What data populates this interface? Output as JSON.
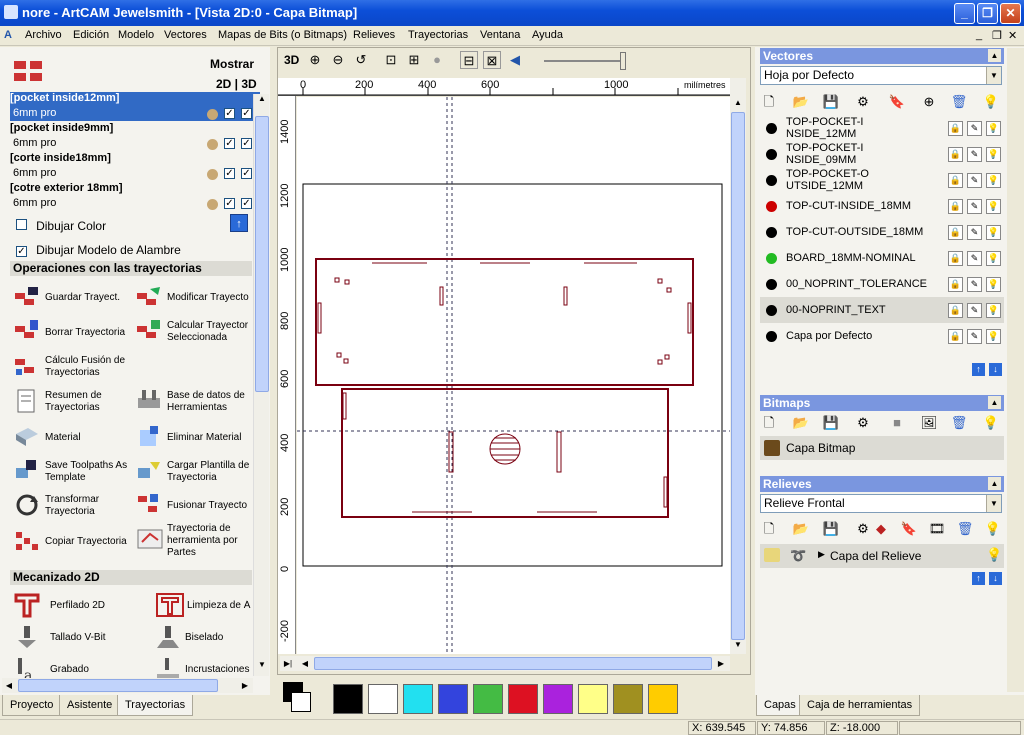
{
  "window": {
    "title": "nore - ArtCAM Jewelsmith - [Vista 2D:0 - Capa Bitmap]"
  },
  "menu": [
    "Archivo",
    "Edición",
    "Modelo",
    "Vectores",
    "Mapas de Bits (o Bitmaps)",
    "Relieves",
    "Trayectorias",
    "Ventana",
    "Ayuda"
  ],
  "left": {
    "mostrar": "Mostrar",
    "view_toggle": "2D | 3D",
    "toolpaths": [
      {
        "name": "[pocket inside12mm]",
        "tool": "6mm pro",
        "selected": true
      },
      {
        "name": "[pocket inside9mm]",
        "tool": "6mm pro",
        "selected": false
      },
      {
        "name": "[corte inside18mm]",
        "tool": "6mm pro",
        "selected": false
      },
      {
        "name": "[cotre exterior 18mm]",
        "tool": "6mm pro",
        "selected": false
      }
    ],
    "dibujar_color": "Dibujar Color",
    "dibujar_modelo": "Dibujar Modelo de Alambre",
    "section_ops": "Operaciones con las trayectorias",
    "ops": [
      {
        "l1": "Guardar Trayect.",
        "l2": ""
      },
      {
        "l1": "Modificar Trayecto",
        "l2": ""
      },
      {
        "l1": "Borrar Trayectoria",
        "l2": ""
      },
      {
        "l1": "Calcular Trayector",
        "l2": "Seleccionada"
      },
      {
        "l1": "Cálculo Fusión de",
        "l2": "Trayectorias"
      },
      {
        "l1": "Base de datos de",
        "l2": "Herramientas"
      },
      {
        "l1": "Resumen de",
        "l2": "Trayectorias"
      },
      {
        "l1": "Material",
        "l2": ""
      },
      {
        "l1": "Eliminar Material",
        "l2": ""
      },
      {
        "l1": "Save Toolpaths As",
        "l2": "Template"
      },
      {
        "l1": "Cargar Plantilla de",
        "l2": "Trayectoria"
      },
      {
        "l1": "Transformar",
        "l2": "Trayectoria"
      },
      {
        "l1": "Fusionar Trayecto",
        "l2": ""
      },
      {
        "l1": "Copiar Trayectoria",
        "l2": ""
      },
      {
        "l1": "Trayectoria de",
        "l2": "herramienta por",
        "l3": "Partes"
      }
    ],
    "section_mec": "Mecanizado 2D",
    "mec": [
      "Perfilado 2D",
      "Limpieza de Á",
      "Tallado V-Bit",
      "Biselado",
      "Grabado",
      "Incrustaciones"
    ],
    "tabs": [
      "Proyecto",
      "Asistente",
      "Trayectorias"
    ]
  },
  "view": {
    "label_3d": "3D",
    "units": "milímetres",
    "ruler_top": [
      "0",
      "200",
      "400",
      "600",
      "1000"
    ],
    "ruler_left": [
      "1400",
      "1200",
      "1000",
      "800",
      "600",
      "400",
      "200",
      "0",
      "-200"
    ]
  },
  "right": {
    "vectores_title": "Vectores",
    "vectores_select": "Hoja por Defecto",
    "layers": [
      {
        "name": "TOP-POCKET-INSIDE_12MM",
        "color": "#000000"
      },
      {
        "name": "TOP-POCKET-INSIDE_09MM",
        "color": "#000000"
      },
      {
        "name": "TOP-POCKET-OUTSIDE_12MM",
        "color": "#000000"
      },
      {
        "name": "TOP-CUT-INSIDE_18MM",
        "color": "#cc0000"
      },
      {
        "name": "TOP-CUT-OUTSIDE_18MM",
        "color": "#000000"
      },
      {
        "name": "BOARD_18MM-NOMINAL",
        "color": "#22bb22"
      },
      {
        "name": "00_NOPRINT_TOLERANCE",
        "color": "#000000"
      },
      {
        "name": "00-NOPRINT_TEXT",
        "color": "#000000"
      },
      {
        "name": "Capa por Defecto",
        "color": "#000000"
      }
    ],
    "bitmaps_title": "Bitmaps",
    "bitmap_layer": "Capa Bitmap",
    "relieves_title": "Relieves",
    "relieves_select": "Relieve Frontal",
    "relief_layer": "Capa del Relieve",
    "tabs": [
      "Capas",
      "Caja de herramientas"
    ]
  },
  "palette": [
    "#000000",
    "#ffffff",
    "#22e0f0",
    "#3344dd",
    "#44bb44",
    "#dd1122",
    "#aa22dd",
    "#ffff88",
    "#a09020",
    "#ffcc00"
  ],
  "status": {
    "x": "X: 639.545",
    "y": "Y: 74.856",
    "z": "Z: -18.000"
  }
}
